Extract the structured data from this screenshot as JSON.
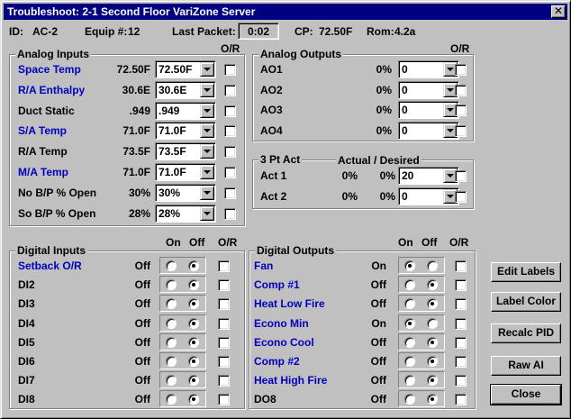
{
  "window": {
    "title": "Troubleshoot: 2-1  Second Floor VariZone Server",
    "close_label": "✕"
  },
  "header": {
    "id_label": "ID:",
    "id_value": "AC-2",
    "equip_label": "Equip #:",
    "equip_value": "12",
    "last_packet_label": "Last Packet:",
    "last_packet_value": "0:02",
    "cp_label": "CP:",
    "cp_value": "72.50F",
    "rom_label": "Rom:",
    "rom_value": "4.2a"
  },
  "analog_inputs": {
    "title": "Analog Inputs",
    "or_header": "O/R",
    "rows": [
      {
        "label": "Space Temp",
        "value": "72.50F",
        "setting": "72.50F",
        "blue": true
      },
      {
        "label": "R/A Enthalpy",
        "value": "30.6E",
        "setting": "30.6E",
        "blue": true
      },
      {
        "label": "Duct Static",
        "value": ".949",
        "setting": ".949",
        "blue": false
      },
      {
        "label": "S/A Temp",
        "value": "71.0F",
        "setting": "71.0F",
        "blue": true
      },
      {
        "label": "R/A Temp",
        "value": "73.5F",
        "setting": "73.5F",
        "blue": false
      },
      {
        "label": "M/A Temp",
        "value": "71.0F",
        "setting": "71.0F",
        "blue": true
      },
      {
        "label": "No B/P % Open",
        "value": "30%",
        "setting": "30%",
        "blue": false
      },
      {
        "label": "So B/P % Open",
        "value": "28%",
        "setting": "28%",
        "blue": false
      }
    ]
  },
  "analog_outputs": {
    "title": "Analog Outputs",
    "or_header": "O/R",
    "rows": [
      {
        "label": "AO1",
        "value": "0%",
        "setting": "0"
      },
      {
        "label": "AO2",
        "value": "0%",
        "setting": "0"
      },
      {
        "label": "AO3",
        "value": "0%",
        "setting": "0"
      },
      {
        "label": "AO4",
        "value": "0%",
        "setting": "0"
      }
    ]
  },
  "three_pt": {
    "title": "3 Pt Act",
    "header": "Actual / Desired",
    "rows": [
      {
        "label": "Act 1",
        "actual": "0%",
        "desired": "0%",
        "setting": "20"
      },
      {
        "label": "Act 2",
        "actual": "0%",
        "desired": "0%",
        "setting": "0"
      }
    ]
  },
  "digital_inputs": {
    "title": "Digital Inputs",
    "on_header": "On",
    "off_header": "Off",
    "or_header": "O/R",
    "rows": [
      {
        "label": "Setback O/R",
        "value": "Off",
        "state": "off",
        "blue": true
      },
      {
        "label": "DI2",
        "value": "Off",
        "state": "off",
        "blue": false
      },
      {
        "label": "DI3",
        "value": "Off",
        "state": "off",
        "blue": false
      },
      {
        "label": "DI4",
        "value": "Off",
        "state": "off",
        "blue": false
      },
      {
        "label": "DI5",
        "value": "Off",
        "state": "off",
        "blue": false
      },
      {
        "label": "DI6",
        "value": "Off",
        "state": "off",
        "blue": false
      },
      {
        "label": "DI7",
        "value": "Off",
        "state": "off",
        "blue": false
      },
      {
        "label": "DI8",
        "value": "Off",
        "state": "off",
        "blue": false
      }
    ]
  },
  "digital_outputs": {
    "title": "Digital Outputs",
    "on_header": "On",
    "off_header": "Off",
    "or_header": "O/R",
    "rows": [
      {
        "label": "Fan",
        "value": "On",
        "state": "on",
        "blue": true
      },
      {
        "label": "Comp #1",
        "value": "Off",
        "state": "off",
        "blue": true
      },
      {
        "label": "Heat Low Fire",
        "value": "Off",
        "state": "off",
        "blue": true
      },
      {
        "label": "Econo Min",
        "value": "On",
        "state": "on",
        "blue": true
      },
      {
        "label": "Econo Cool",
        "value": "Off",
        "state": "off",
        "blue": true
      },
      {
        "label": "Comp #2",
        "value": "Off",
        "state": "off",
        "blue": true
      },
      {
        "label": "Heat High Fire",
        "value": "Off",
        "state": "off",
        "blue": true
      },
      {
        "label": "DO8",
        "value": "Off",
        "state": "off",
        "blue": false
      }
    ]
  },
  "buttons": {
    "edit_labels": "Edit Labels",
    "label_color": "Label Color",
    "recalc_pid": "Recalc PID",
    "raw_ai": "Raw AI",
    "close": "Close"
  },
  "colors": {
    "title_bar": "#000080",
    "face": "#c0c0c0",
    "label_blue": "#0000c0"
  }
}
